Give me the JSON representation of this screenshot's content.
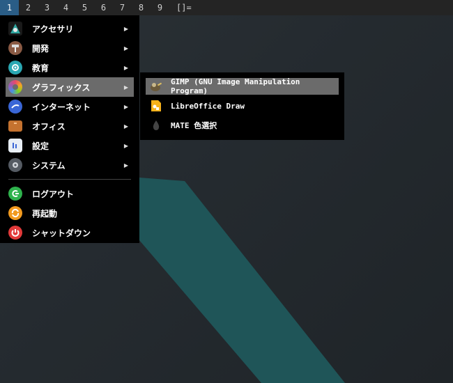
{
  "topbar": {
    "workspaces": [
      "1",
      "2",
      "3",
      "4",
      "5",
      "6",
      "7",
      "8",
      "9"
    ],
    "active_workspace": "1",
    "layout_indicator": "[]="
  },
  "menu": {
    "items": [
      {
        "label": "アクセサリ",
        "icon": "accessories-icon",
        "has_submenu": true
      },
      {
        "label": "開発",
        "icon": "development-icon",
        "has_submenu": true
      },
      {
        "label": "教育",
        "icon": "education-icon",
        "has_submenu": true
      },
      {
        "label": "グラフィックス",
        "icon": "graphics-icon",
        "has_submenu": true,
        "selected": true
      },
      {
        "label": "インターネット",
        "icon": "internet-icon",
        "has_submenu": true
      },
      {
        "label": "オフィス",
        "icon": "office-icon",
        "has_submenu": true
      },
      {
        "label": "設定",
        "icon": "settings-icon",
        "has_submenu": true
      },
      {
        "label": "システム",
        "icon": "system-icon",
        "has_submenu": true
      }
    ],
    "actions": [
      {
        "label": "ログアウト",
        "icon": "logout-icon"
      },
      {
        "label": "再起動",
        "icon": "restart-icon"
      },
      {
        "label": "シャットダウン",
        "icon": "shutdown-icon"
      }
    ]
  },
  "submenu": {
    "items": [
      {
        "label": "GIMP (GNU Image Manipulation Program)",
        "icon": "gimp-icon",
        "selected": true
      },
      {
        "label": "LibreOffice Draw",
        "icon": "libreoffice-draw-icon"
      },
      {
        "label": "MATE 色選択",
        "icon": "color-picker-icon"
      }
    ]
  },
  "colors": {
    "topbar_bg": "#242424",
    "active_workspace": "#2a5d86",
    "menu_bg": "#000000",
    "selected_item": "#6b6b6b",
    "desktop_stripe": "#1f5558"
  }
}
